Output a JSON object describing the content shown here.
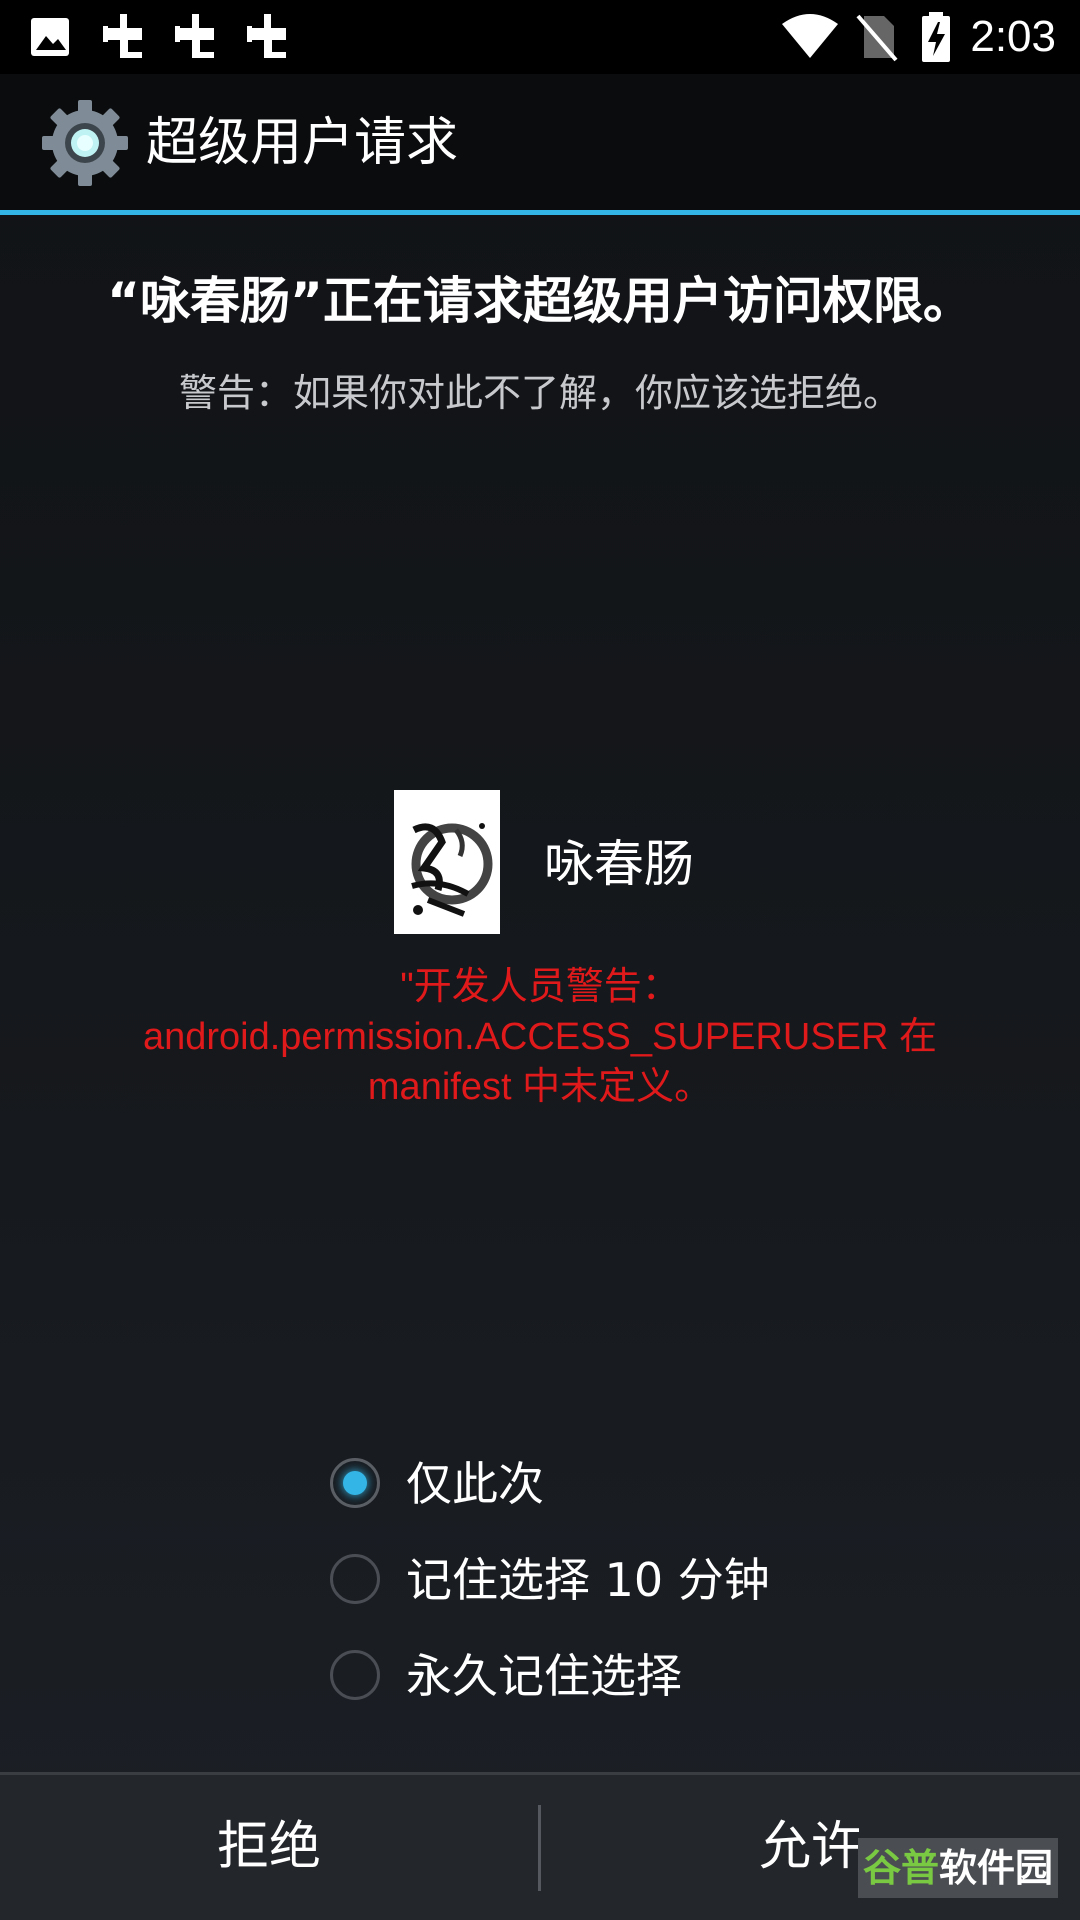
{
  "status_bar": {
    "clock": "2:03",
    "icons": [
      "image-icon",
      "bug-icon",
      "bug-icon",
      "bug-icon",
      "wifi-icon",
      "no-sim-icon",
      "battery-charging-icon"
    ]
  },
  "title_bar": {
    "title": "超级用户请求",
    "icon": "gear-icon"
  },
  "prompt": {
    "headline": "“咏春肠”正在请求超级用户访问权限。",
    "warning": "警告：如果你对此不了解，你应该选拒绝。"
  },
  "app": {
    "name": "咏春肠",
    "icon": "app-calligraphy-icon",
    "developer_warning": "\"开发人员警告：android.permission.ACCESS_SUPERUSER 在 manifest 中未定义。"
  },
  "options": [
    {
      "label": "仅此次",
      "selected": true
    },
    {
      "label": "记住选择 10 分钟",
      "selected": false
    },
    {
      "label": "永久记住选择",
      "selected": false
    }
  ],
  "buttons": {
    "deny": "拒绝",
    "allow": "允许"
  },
  "watermark": {
    "part1": "谷普",
    "part2": "软件园"
  },
  "colors": {
    "accent": "#33b5e5",
    "warning": "#e0191b",
    "watermark_green": "#7ac943"
  }
}
